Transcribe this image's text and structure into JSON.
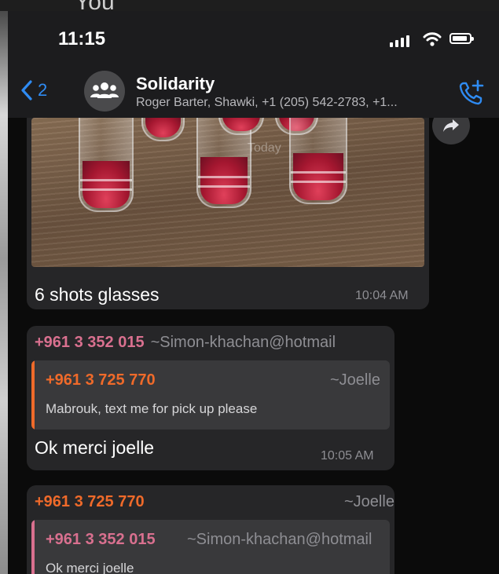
{
  "background_peek_text": "You",
  "status_bar": {
    "time": "11:15"
  },
  "header": {
    "back_count": "2",
    "group_name": "Solidarity",
    "members": "Roger Barter, Shawki, +1 (205) 542-2783, +1..."
  },
  "messages": [
    {
      "type": "photo",
      "watermark": "Today",
      "caption": "6 shots glasses",
      "time": "10:04 AM"
    },
    {
      "type": "reply",
      "sender_phone": "+961 3 352 015",
      "sender_alias": "~Simon-khachan@hotmail",
      "sender_color": "#d9708f",
      "quoted_phone": "+961 3 725 770",
      "quoted_alias": "~Joelle",
      "quoted_color": "#ef6a2a",
      "quoted_text": "Mabrouk, text me for pick up please",
      "text": "Ok merci joelle",
      "time": "10:05 AM"
    },
    {
      "type": "reply",
      "sender_phone": "+961 3 725 770",
      "sender_alias": "~Joelle",
      "sender_color": "#ef6a2a",
      "quoted_phone": "+961 3 352 015",
      "quoted_alias": "~Simon-khachan@hotmail",
      "quoted_color": "#d9708f",
      "quoted_text": "Ok merci joelle"
    }
  ],
  "icons": [
    "signal-icon",
    "wifi-icon",
    "battery-icon",
    "back-chevron-icon",
    "group-avatar-icon",
    "add-call-icon",
    "forward-icon"
  ],
  "colors": {
    "accent": "#2f8bf2",
    "bubble": "#262628",
    "header": "#1c1c1e"
  }
}
